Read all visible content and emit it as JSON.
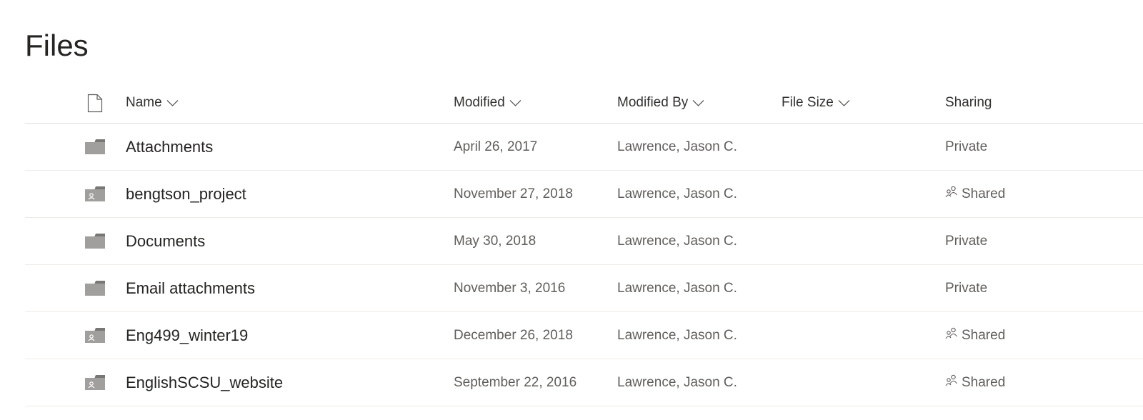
{
  "page": {
    "title": "Files"
  },
  "columns": {
    "name": "Name",
    "modified": "Modified",
    "modified_by": "Modified By",
    "file_size": "File Size",
    "sharing": "Sharing"
  },
  "icons": {
    "header": "file-type-icon",
    "folder": "folder-icon",
    "shared_folder": "shared-folder-icon",
    "people": "people-icon",
    "sort": "chevron-down-icon"
  },
  "colors": {
    "folder": "#a19f9d",
    "folder_tab": "#797775",
    "divider": "#edebe9"
  },
  "files": [
    {
      "name": "Attachments",
      "modified": "April 26, 2017",
      "modified_by": "Lawrence, Jason C.",
      "file_size": "",
      "sharing": "Private",
      "shared": false
    },
    {
      "name": "bengtson_project",
      "modified": "November 27, 2018",
      "modified_by": "Lawrence, Jason C.",
      "file_size": "",
      "sharing": "Shared",
      "shared": true
    },
    {
      "name": "Documents",
      "modified": "May 30, 2018",
      "modified_by": "Lawrence, Jason C.",
      "file_size": "",
      "sharing": "Private",
      "shared": false
    },
    {
      "name": "Email attachments",
      "modified": "November 3, 2016",
      "modified_by": "Lawrence, Jason C.",
      "file_size": "",
      "sharing": "Private",
      "shared": false
    },
    {
      "name": "Eng499_winter19",
      "modified": "December 26, 2018",
      "modified_by": "Lawrence, Jason C.",
      "file_size": "",
      "sharing": "Shared",
      "shared": true
    },
    {
      "name": "EnglishSCSU_website",
      "modified": "September 22, 2016",
      "modified_by": "Lawrence, Jason C.",
      "file_size": "",
      "sharing": "Shared",
      "shared": true
    }
  ]
}
